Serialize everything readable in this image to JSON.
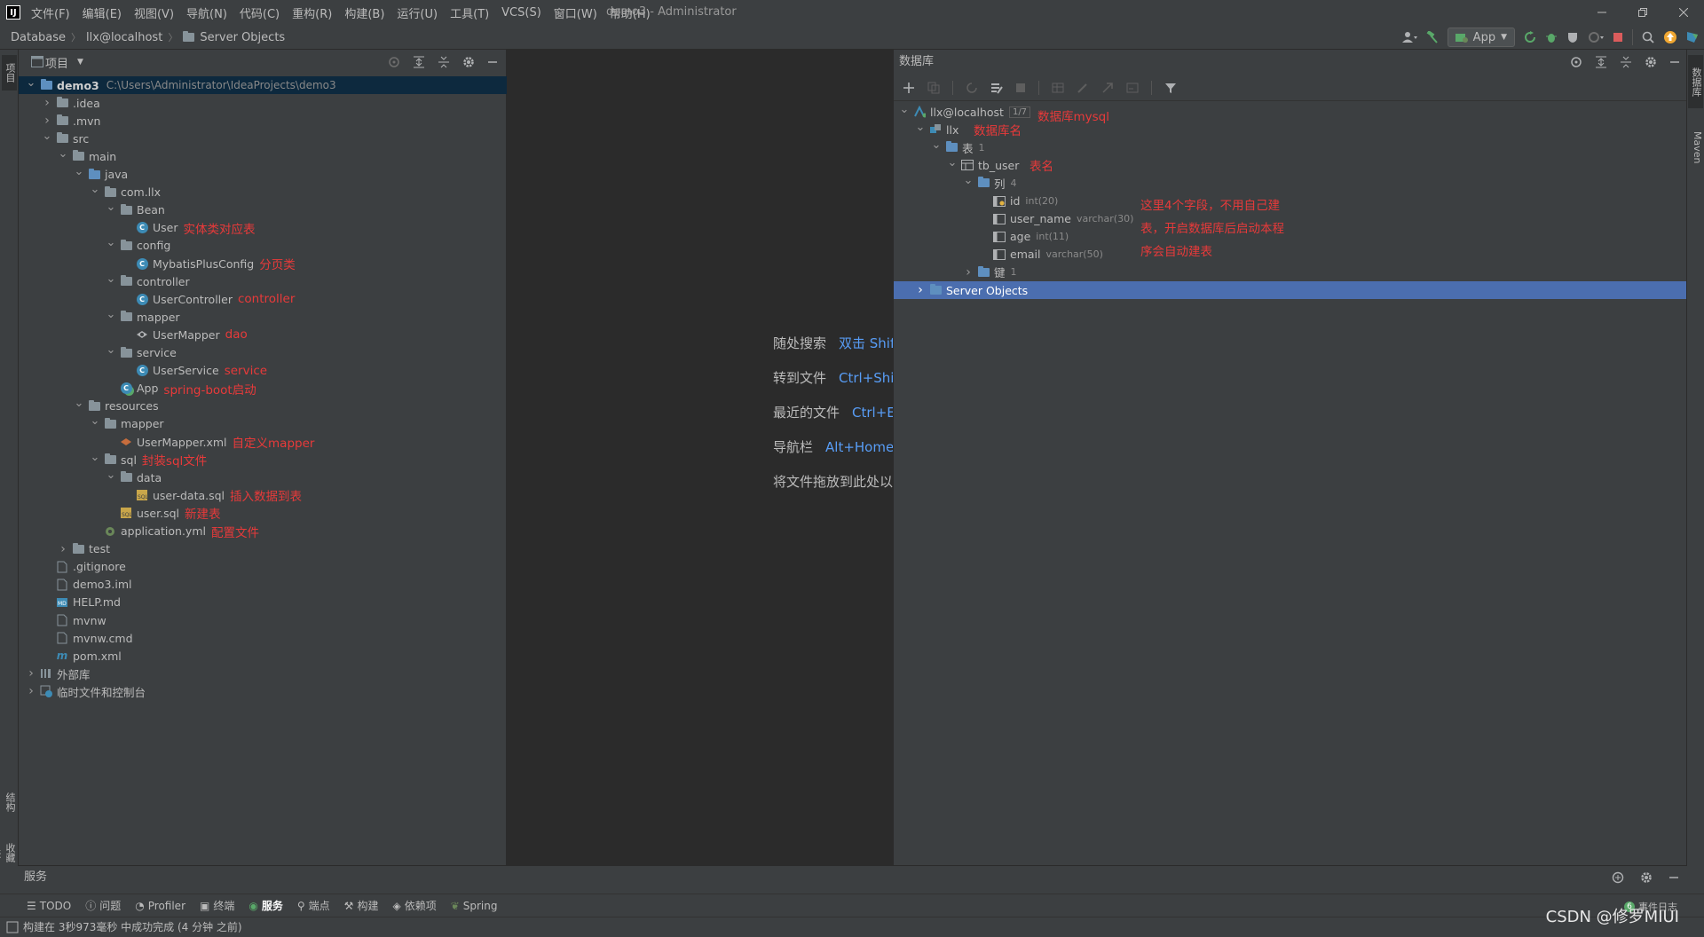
{
  "app": {
    "window_title": "demo3 - Administrator",
    "logo_text": "IJ"
  },
  "menu": [
    "文件(F)",
    "编辑(E)",
    "视图(V)",
    "导航(N)",
    "代码(C)",
    "重构(R)",
    "构建(B)",
    "运行(U)",
    "工具(T)",
    "VCS(S)",
    "窗口(W)",
    "帮助(H)"
  ],
  "breadcrumb": [
    "Database",
    "llx@localhost",
    "Server Objects"
  ],
  "toolbar": {
    "run_config": "App"
  },
  "left_strip": {
    "project_tab": "项目",
    "structure_tab": "结构",
    "favorites_tab": "收藏夹"
  },
  "right_strip": {
    "database_tab": "数据库",
    "maven_tab": "Maven"
  },
  "project_panel": {
    "title": "项目",
    "tree": [
      {
        "label": "demo3",
        "path": "C:\\Users\\Administrator\\IdeaProjects\\demo3",
        "note": "",
        "depth": 0,
        "icon": "folder-blue",
        "expanded": true,
        "selected": true
      },
      {
        "label": ".idea",
        "path": "",
        "note": "",
        "depth": 1,
        "icon": "folder",
        "expanded": false
      },
      {
        "label": ".mvn",
        "path": "",
        "note": "",
        "depth": 1,
        "icon": "folder",
        "expanded": false
      },
      {
        "label": "src",
        "path": "",
        "note": "",
        "depth": 1,
        "icon": "folder",
        "expanded": true
      },
      {
        "label": "main",
        "path": "",
        "note": "",
        "depth": 2,
        "icon": "folder",
        "expanded": true
      },
      {
        "label": "java",
        "path": "",
        "note": "",
        "depth": 3,
        "icon": "folder-blue",
        "expanded": true
      },
      {
        "label": "com.llx",
        "path": "",
        "note": "",
        "depth": 4,
        "icon": "folder",
        "expanded": true
      },
      {
        "label": "Bean",
        "path": "",
        "note": "",
        "depth": 5,
        "icon": "folder",
        "expanded": true
      },
      {
        "label": "User",
        "path": "",
        "note": "实体类对应表",
        "depth": 6,
        "icon": "class"
      },
      {
        "label": "config",
        "path": "",
        "note": "",
        "depth": 5,
        "icon": "folder",
        "expanded": true
      },
      {
        "label": "MybatisPlusConfig",
        "path": "",
        "note": "分页类",
        "depth": 6,
        "icon": "class"
      },
      {
        "label": "controller",
        "path": "",
        "note": "",
        "depth": 5,
        "icon": "folder",
        "expanded": true
      },
      {
        "label": "UserController",
        "path": "",
        "note": "controller",
        "depth": 6,
        "icon": "class"
      },
      {
        "label": "mapper",
        "path": "",
        "note": "",
        "depth": 5,
        "icon": "folder",
        "expanded": true
      },
      {
        "label": "UserMapper",
        "path": "",
        "note": "dao",
        "depth": 6,
        "icon": "mapper"
      },
      {
        "label": "service",
        "path": "",
        "note": "",
        "depth": 5,
        "icon": "folder",
        "expanded": true
      },
      {
        "label": "UserService",
        "path": "",
        "note": "service",
        "depth": 6,
        "icon": "class"
      },
      {
        "label": "App",
        "path": "",
        "note": "spring-boot启动",
        "depth": 5,
        "icon": "class-run"
      },
      {
        "label": "resources",
        "path": "",
        "note": "",
        "depth": 3,
        "icon": "folder",
        "expanded": true
      },
      {
        "label": "mapper",
        "path": "",
        "note": "",
        "depth": 4,
        "icon": "folder",
        "expanded": true
      },
      {
        "label": "UserMapper.xml",
        "path": "",
        "note": "自定义mapper",
        "depth": 5,
        "icon": "xml"
      },
      {
        "label": "sql",
        "path": "",
        "note": "封装sql文件",
        "depth": 4,
        "icon": "folder",
        "expanded": true
      },
      {
        "label": "data",
        "path": "",
        "note": "",
        "depth": 5,
        "icon": "folder",
        "expanded": true
      },
      {
        "label": "user-data.sql",
        "path": "",
        "note": "插入数据到表",
        "depth": 6,
        "icon": "sql"
      },
      {
        "label": "user.sql",
        "path": "",
        "note": "新建表",
        "depth": 5,
        "icon": "sql"
      },
      {
        "label": "application.yml",
        "path": "",
        "note": "配置文件",
        "depth": 4,
        "icon": "yml"
      },
      {
        "label": "test",
        "path": "",
        "note": "",
        "depth": 2,
        "icon": "folder",
        "expanded": false
      },
      {
        "label": ".gitignore",
        "path": "",
        "note": "",
        "depth": 1,
        "icon": "file"
      },
      {
        "label": "demo3.iml",
        "path": "",
        "note": "",
        "depth": 1,
        "icon": "file"
      },
      {
        "label": "HELP.md",
        "path": "",
        "note": "",
        "depth": 1,
        "icon": "md"
      },
      {
        "label": "mvnw",
        "path": "",
        "note": "",
        "depth": 1,
        "icon": "file"
      },
      {
        "label": "mvnw.cmd",
        "path": "",
        "note": "",
        "depth": 1,
        "icon": "file"
      },
      {
        "label": "pom.xml",
        "path": "",
        "note": "",
        "depth": 1,
        "icon": "maven"
      },
      {
        "label": "外部库",
        "path": "",
        "note": "",
        "depth": 0,
        "icon": "lib",
        "expanded": false
      },
      {
        "label": "临时文件和控制台",
        "path": "",
        "note": "",
        "depth": 0,
        "icon": "scratch",
        "expanded": false
      }
    ]
  },
  "editor": {
    "hints": [
      {
        "label": "随处搜索",
        "key": "双击 Shift"
      },
      {
        "label": "转到文件",
        "key": "Ctrl+Shift+N"
      },
      {
        "label": "最近的文件",
        "key": "Ctrl+E"
      },
      {
        "label": "导航栏",
        "key": "Alt+Home"
      },
      {
        "label": "将文件拖放到此处以打开",
        "key": ""
      }
    ]
  },
  "database_panel": {
    "title": "数据库",
    "tree": [
      {
        "label": "llx@localhost",
        "type": "",
        "count": "1/7",
        "depth": 0,
        "icon": "datasource",
        "arrow": "down"
      },
      {
        "label": "llx",
        "type": "",
        "count": "",
        "depth": 1,
        "icon": "schema",
        "arrow": "down"
      },
      {
        "label": "表",
        "type": "1",
        "count": "",
        "depth": 2,
        "icon": "folder",
        "arrow": "down"
      },
      {
        "label": "tb_user",
        "type": "",
        "count": "",
        "depth": 3,
        "icon": "table",
        "arrow": "down"
      },
      {
        "label": "列",
        "type": "4",
        "count": "",
        "depth": 4,
        "icon": "folder",
        "arrow": "down"
      },
      {
        "label": "id",
        "type": "int(20)",
        "count": "",
        "depth": 5,
        "icon": "key-column"
      },
      {
        "label": "user_name",
        "type": "varchar(30)",
        "count": "",
        "depth": 5,
        "icon": "column"
      },
      {
        "label": "age",
        "type": "int(11)",
        "count": "",
        "depth": 5,
        "icon": "column"
      },
      {
        "label": "email",
        "type": "varchar(50)",
        "count": "",
        "depth": 5,
        "icon": "column"
      },
      {
        "label": "键",
        "type": "1",
        "count": "",
        "depth": 4,
        "icon": "folder",
        "arrow": "right"
      },
      {
        "label": "Server Objects",
        "type": "",
        "count": "",
        "depth": 1,
        "icon": "folder",
        "arrow": "right",
        "selected": true
      }
    ],
    "notes": {
      "datasource": "数据库mysql",
      "schema": "数据库名",
      "table": "表名",
      "columns_line1": "这里4个字段，不用自己建",
      "columns_line2": "表，开启数据库后启动本程",
      "columns_line3": "序会自动建表"
    }
  },
  "services": {
    "title": "服务"
  },
  "tool_tabs": [
    "TODO",
    "问题",
    "Profiler",
    "终端",
    "服务",
    "端点",
    "构建",
    "依赖项",
    "Spring"
  ],
  "status": {
    "message": "构建在 3秒973毫秒 中成功完成 (4 分钟 之前)",
    "event_log": "事件日志",
    "event_count": "6"
  },
  "watermark": "CSDN @修罗MIUI",
  "colors": {
    "annotation": "#e83a3a",
    "selection": "#4b6eaf",
    "accent": "#589df6"
  }
}
